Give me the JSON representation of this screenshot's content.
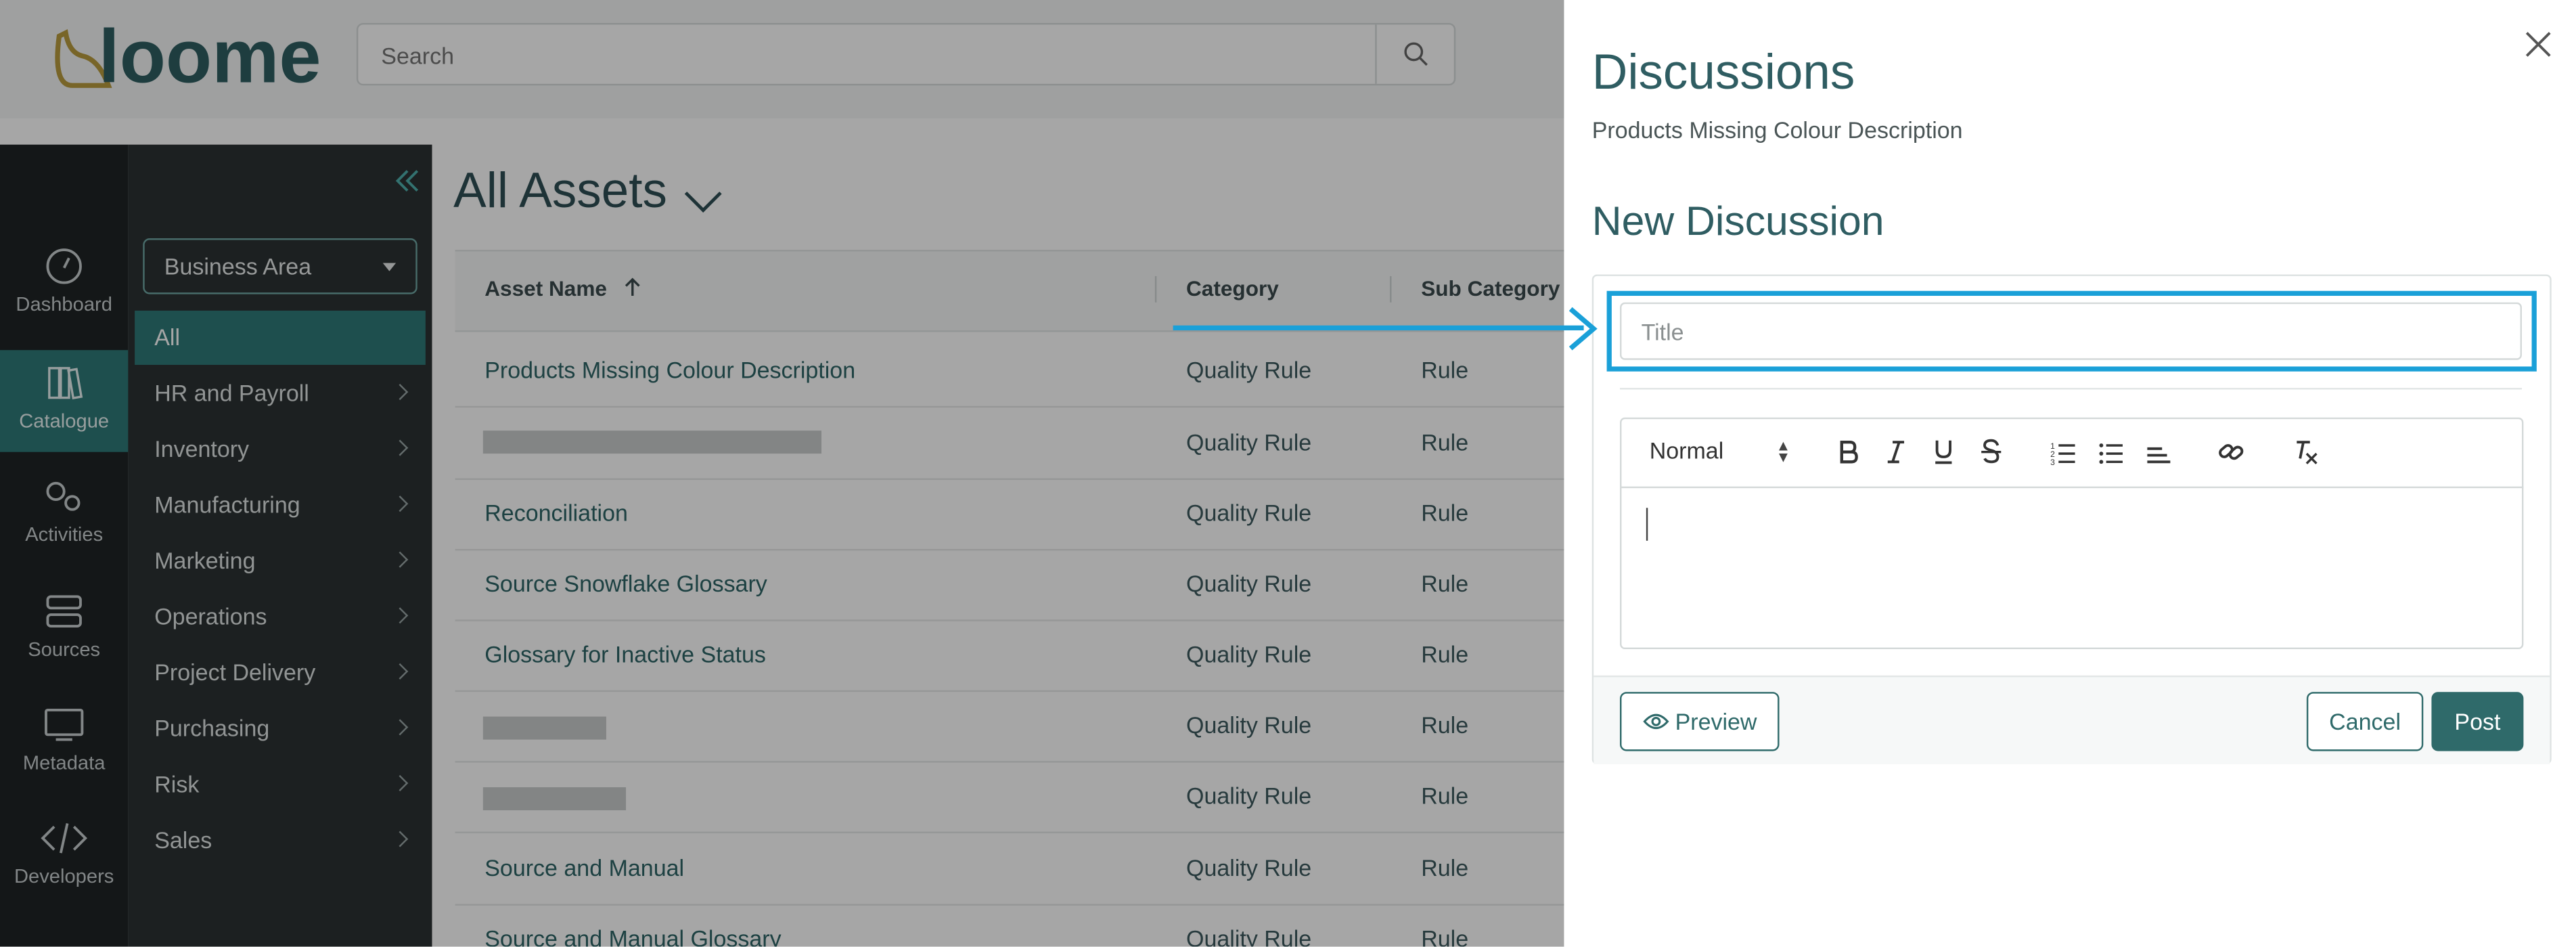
{
  "app": {
    "logo_text": "loome",
    "search_placeholder": "Search"
  },
  "leftnav": [
    {
      "label": "Dashboard",
      "icon": "dashboard-icon",
      "active": false
    },
    {
      "label": "Catalogue",
      "icon": "catalogue-icon",
      "active": true
    },
    {
      "label": "Activities",
      "icon": "activities-icon",
      "active": false
    },
    {
      "label": "Sources",
      "icon": "sources-icon",
      "active": false
    },
    {
      "label": "Metadata",
      "icon": "metadata-icon",
      "active": false
    },
    {
      "label": "Developers",
      "icon": "developers-icon",
      "active": false
    }
  ],
  "subnav": {
    "filter_label": "Business Area",
    "items": [
      "All",
      "HR and Payroll",
      "Inventory",
      "Manufacturing",
      "Marketing",
      "Operations",
      "Project Delivery",
      "Purchasing",
      "Risk",
      "Sales"
    ]
  },
  "main": {
    "title": "All Assets",
    "columns": [
      "Asset Name",
      "Category",
      "Sub Category"
    ],
    "rows": [
      {
        "name": "Products Missing Colour Description",
        "category": "Quality Rule",
        "sub": "Rule"
      },
      {
        "name": "",
        "category": "Quality Rule",
        "sub": "Rule"
      },
      {
        "name": "Reconciliation",
        "category": "Quality Rule",
        "sub": "Rule"
      },
      {
        "name": "Source Snowflake Glossary",
        "category": "Quality Rule",
        "sub": "Rule"
      },
      {
        "name": "Glossary for Inactive Status",
        "category": "Quality Rule",
        "sub": "Rule"
      },
      {
        "name": "",
        "category": "Quality Rule",
        "sub": "Rule"
      },
      {
        "name": "",
        "category": "Quality Rule",
        "sub": "Rule"
      },
      {
        "name": "Source and Manual",
        "category": "Quality Rule",
        "sub": "Rule"
      },
      {
        "name": "Source and Manual Glossary",
        "category": "Quality Rule",
        "sub": "Rule"
      }
    ]
  },
  "panel": {
    "title": "Discussions",
    "subtitle": "Products Missing Colour Description",
    "new_heading": "New Discussion",
    "title_placeholder": "Title",
    "format_value": "Normal",
    "preview_label": "Preview",
    "cancel_label": "Cancel",
    "post_label": "Post"
  },
  "colors": {
    "accent": "#2f6a6a",
    "highlight": "#1aa0d8",
    "sidebar": "#1f2425",
    "active": "#2f7a78"
  }
}
